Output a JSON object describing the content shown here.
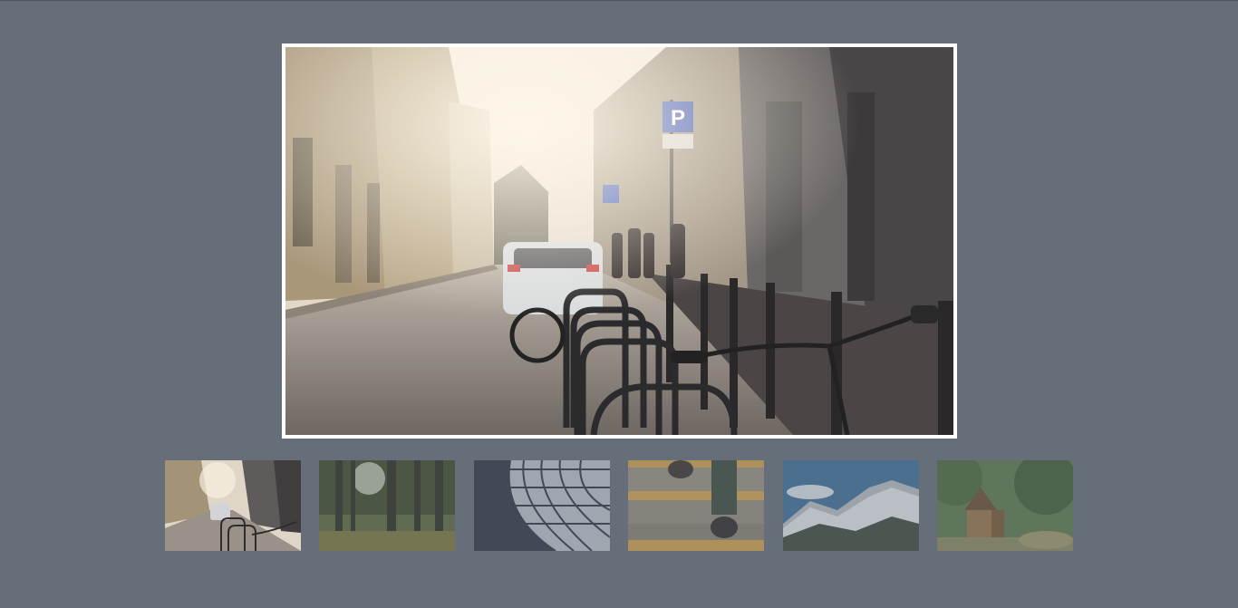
{
  "gallery": {
    "main_image": {
      "name": "street-with-bike-rack",
      "parking_sign_text": "P"
    },
    "thumbnails": [
      {
        "name": "street-with-bike-rack",
        "active": true
      },
      {
        "name": "forest-sunlight",
        "active": false
      },
      {
        "name": "glass-building-curve",
        "active": false
      },
      {
        "name": "stairs-with-feet",
        "active": false
      },
      {
        "name": "snowy-mountains",
        "active": false
      },
      {
        "name": "wooden-hut-in-woods",
        "active": false
      }
    ]
  },
  "colors": {
    "background": "#666e79",
    "frame": "#ffffff"
  }
}
